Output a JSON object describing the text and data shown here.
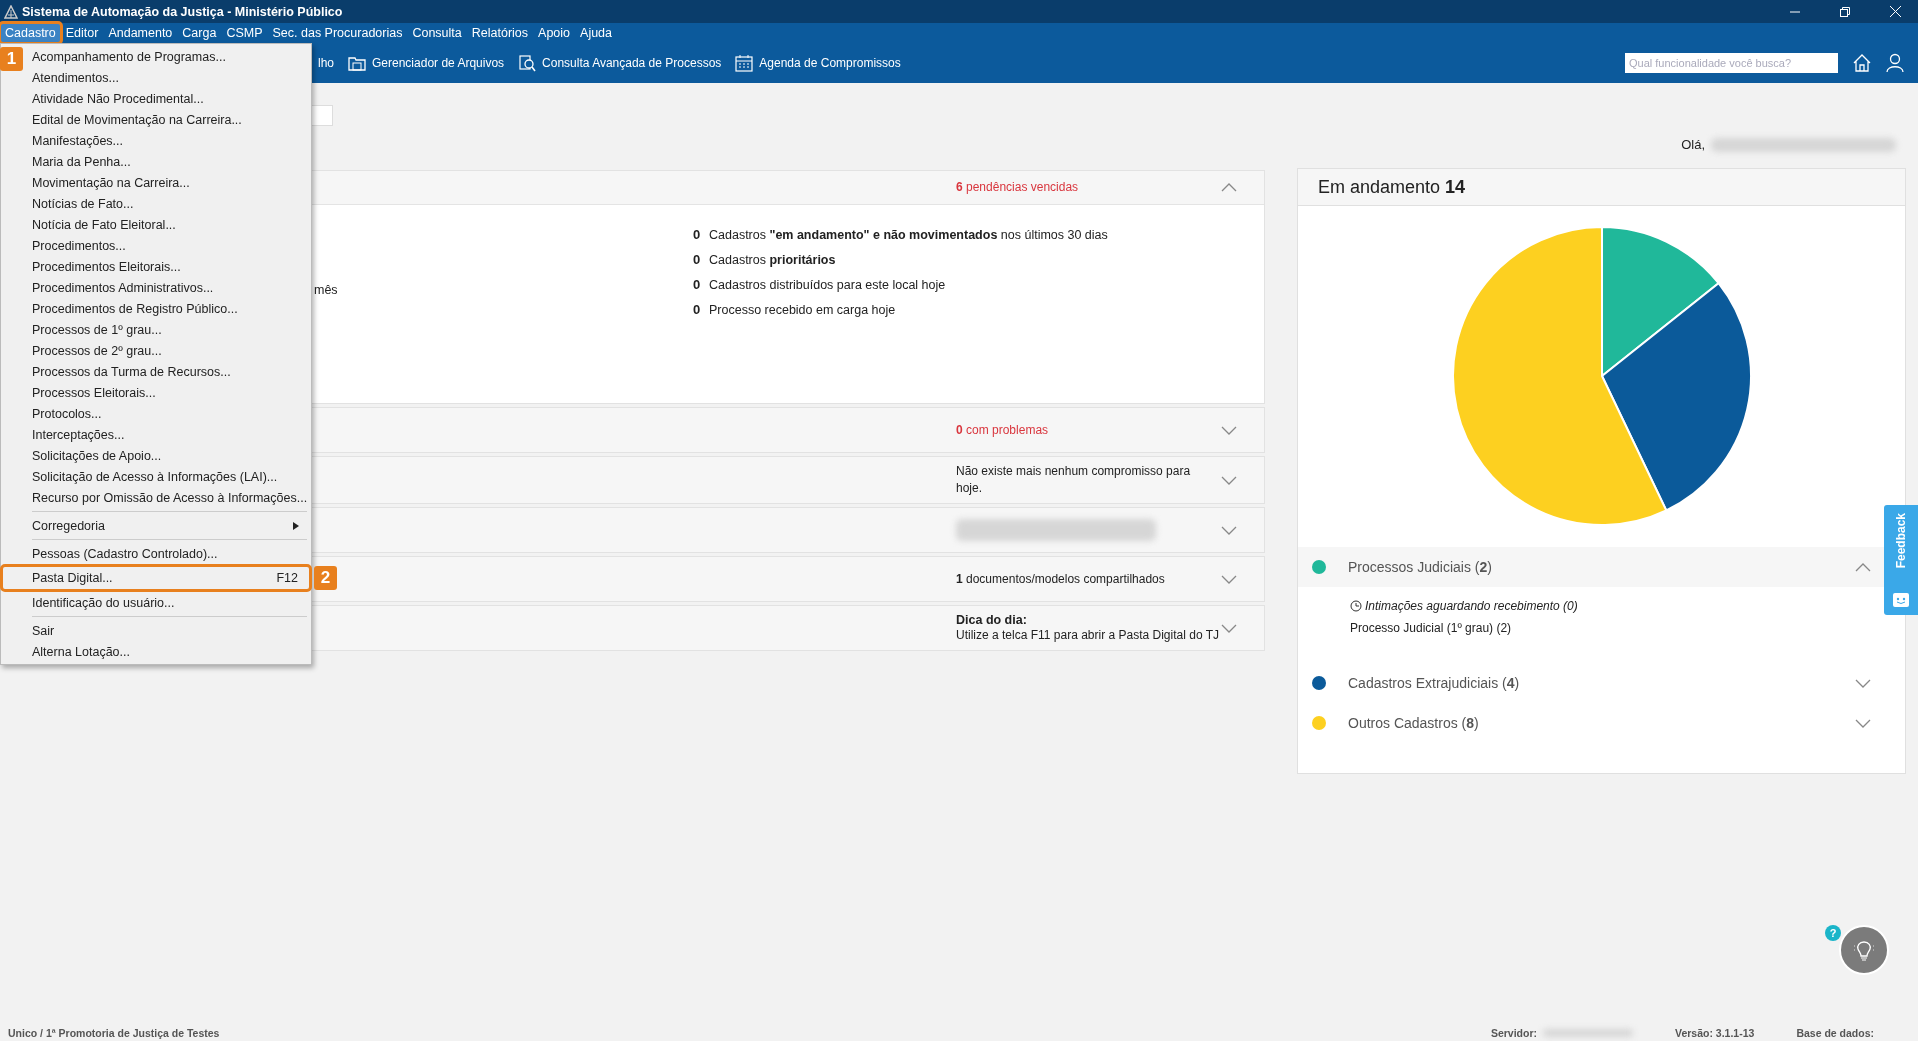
{
  "window": {
    "title": "Sistema de Automação da Justiça - Ministério Público"
  },
  "menubar": [
    {
      "label": "Cadastro",
      "selected": true,
      "callout": "1"
    },
    {
      "label": "Editor",
      "selected": false
    },
    {
      "label": "Andamento",
      "selected": false
    },
    {
      "label": "Carga",
      "selected": false
    },
    {
      "label": "CSMP",
      "selected": false
    },
    {
      "label": "Sec. das Procuradorias",
      "selected": false
    },
    {
      "label": "Consulta",
      "selected": false
    },
    {
      "label": "Relatórios",
      "selected": false
    },
    {
      "label": "Apoio",
      "selected": false
    },
    {
      "label": "Ajuda",
      "selected": false
    }
  ],
  "menu": {
    "items": [
      {
        "kind": "item",
        "label": "Acompanhamento de Programas..."
      },
      {
        "kind": "item",
        "label": "Atendimentos..."
      },
      {
        "kind": "item",
        "label": "Atividade Não Procedimental..."
      },
      {
        "kind": "item",
        "label": "Edital de Movimentação na Carreira..."
      },
      {
        "kind": "item",
        "label": "Manifestações..."
      },
      {
        "kind": "item",
        "label": "Maria da Penha..."
      },
      {
        "kind": "item",
        "label": "Movimentação na Carreira..."
      },
      {
        "kind": "item",
        "label": "Notícias de Fato..."
      },
      {
        "kind": "item",
        "label": "Notícia de Fato Eleitoral..."
      },
      {
        "kind": "item",
        "label": "Procedimentos..."
      },
      {
        "kind": "item",
        "label": "Procedimentos Eleitorais..."
      },
      {
        "kind": "item",
        "label": "Procedimentos Administrativos..."
      },
      {
        "kind": "item",
        "label": "Procedimentos de Registro Público..."
      },
      {
        "kind": "item",
        "label": "Processos de 1º grau..."
      },
      {
        "kind": "item",
        "label": "Processos de 2º grau..."
      },
      {
        "kind": "item",
        "label": "Processos da Turma de Recursos..."
      },
      {
        "kind": "item",
        "label": "Processos Eleitorais..."
      },
      {
        "kind": "item",
        "label": "Protocolos..."
      },
      {
        "kind": "item",
        "label": "Interceptações..."
      },
      {
        "kind": "item",
        "label": "Solicitações de Apoio..."
      },
      {
        "kind": "item",
        "label": "Solicitação de Acesso à Informações (LAI)..."
      },
      {
        "kind": "item",
        "label": "Recurso por Omissão de Acesso à Informações..."
      },
      {
        "kind": "separator"
      },
      {
        "kind": "submenu",
        "label": "Corregedoria"
      },
      {
        "kind": "separator"
      },
      {
        "kind": "item",
        "label": "Pessoas (Cadastro Controlado)..."
      },
      {
        "kind": "item",
        "label": "Pasta Digital...",
        "shortcut": "F12",
        "callout": "2"
      },
      {
        "kind": "item",
        "label": "Identificação do usuário..."
      },
      {
        "kind": "separator"
      },
      {
        "kind": "item",
        "label": "Sair"
      },
      {
        "kind": "item",
        "label": "Alterna Lotação..."
      }
    ]
  },
  "toolbar": {
    "items": [
      {
        "label": "lho"
      },
      {
        "kind": "folder",
        "label": "Gerenciador de Arquivos"
      },
      {
        "kind": "search",
        "label": "Consulta Avançada de Processos"
      },
      {
        "kind": "calendar",
        "label": "Agenda de Compromissos"
      }
    ],
    "search": {
      "placeholder": "Qual funcionalidade você busca?"
    }
  },
  "greeting": "Olá,",
  "cards": [
    {
      "kind": "status",
      "expanded": true,
      "alert": true,
      "summary": "**6** pendências vencidas",
      "left_text": "mês",
      "rows": [
        {
          "count": "0",
          "text": "Cadastros **\"em andamento\" e não movimentados** nos últimos 30 dias"
        },
        {
          "count": "0",
          "text": "Cadastros **prioritários**"
        },
        {
          "count": "0",
          "text": "Cadastros distribuídos para este local hoje"
        },
        {
          "count": "0",
          "text": "Processo recebido em carga hoje"
        }
      ]
    },
    {
      "kind": "status",
      "expanded": false,
      "alert": true,
      "summary": "**0** com problemas"
    },
    {
      "kind": "status",
      "expanded": false,
      "alert": false,
      "summary": "Não existe mais nenhum compromisso para hoje."
    },
    {
      "kind": "blurred",
      "expanded": false
    },
    {
      "kind": "status",
      "expanded": false,
      "alert": false,
      "summary": "**1** documentos/modelos compartilhados"
    },
    {
      "kind": "tip",
      "expanded": false,
      "title": "Dica do dia:",
      "summary": "Utilize a telca F11 para abrir a Pasta Digital do TJ"
    }
  ],
  "summary": {
    "title": "Em andamento **14**",
    "chart_data": {
      "type": "pie",
      "series": [
        {
          "values": [
            14.3,
            28.6,
            57.1
          ]
        }
      ]
    },
    "groups": [
      {
        "label": "Processos Judiciais (**2**)",
        "color": "#20b89a",
        "expanded": true,
        "children": [
          {
            "kind": "pending",
            "label": "Intimações aguardando recebimento (0)"
          },
          {
            "kind": "item",
            "label": "Processo Judicial (1º grau) (2)"
          }
        ]
      },
      {
        "label": "Cadastros Extrajudiciais (**4**)",
        "color": "#0b5a9a",
        "expanded": false
      },
      {
        "label": "Outros Cadastros (**8**)",
        "color": "#fdd020",
        "expanded": false
      }
    ]
  },
  "feedback": {
    "label": "Feedback"
  },
  "help_badge": "?",
  "status_bar": {
    "location": "Unico / 1ª Promotoria de Justiça de Testes",
    "server_label": "Servidor:",
    "version": "Versão: 3.1.1-13",
    "database_label": "Base de dados:"
  }
}
